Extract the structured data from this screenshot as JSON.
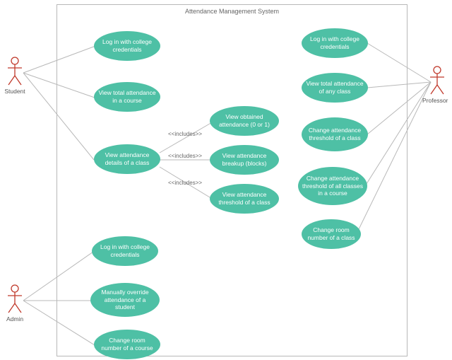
{
  "diagram": {
    "title": "Attendance Management System",
    "actors": {
      "student": "Student",
      "admin": "Admin",
      "professor": "Professor"
    },
    "usecases": {
      "s_login": "Log in with college credentials",
      "s_viewtotal": "View total attendance in a course",
      "s_viewdetails": "View attendance details of a class",
      "inc_obtained": "View obtained attendance (0 or 1)",
      "inc_breakup": "View attendance breakup (blocks)",
      "inc_threshold": "View attendance threshold of a class",
      "a_login": "Log in with college credentials",
      "a_override": "Manually override attendance of a student",
      "a_changeroom": "Change room number of a course",
      "p_login": "Log in with college credentials",
      "p_viewtotal": "View total attendance of any class",
      "p_changethreshold": "Change attendance threshold of a class",
      "p_changethreshold_all": "Change attendance threshold of all classes in a course",
      "p_changeroom": "Change room number of a class"
    },
    "stereotype": {
      "includes": "<<includes>>"
    },
    "colors": {
      "usecase_fill": "#4ec0a5",
      "actor_stroke": "#c0392b",
      "boundary_stroke": "#b8b8b8"
    }
  }
}
